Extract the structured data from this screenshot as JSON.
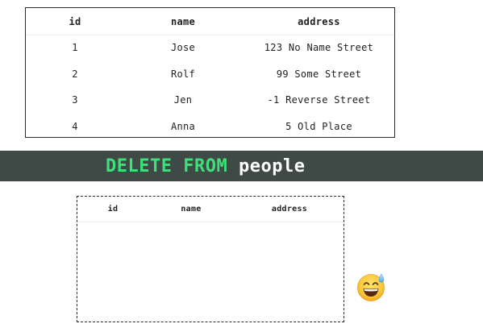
{
  "full_table": {
    "columns": [
      "id",
      "name",
      "address"
    ],
    "rows": [
      [
        "1",
        "Jose",
        "123 No Name Street"
      ],
      [
        "2",
        "Rolf",
        "99 Some Street"
      ],
      [
        "3",
        "Jen",
        "-1 Reverse Street"
      ],
      [
        "4",
        "Anna",
        "5 Old Place"
      ]
    ]
  },
  "sql": {
    "keyword_1": "DELETE",
    "keyword_2": "FROM",
    "table_name": "people",
    "keyword_color": "#3ee07a",
    "banner_color": "#3f4a47"
  },
  "empty_table": {
    "columns": [
      "id",
      "name",
      "address"
    ]
  },
  "emoji": {
    "icon": "grinning-face-with-sweat-icon"
  }
}
